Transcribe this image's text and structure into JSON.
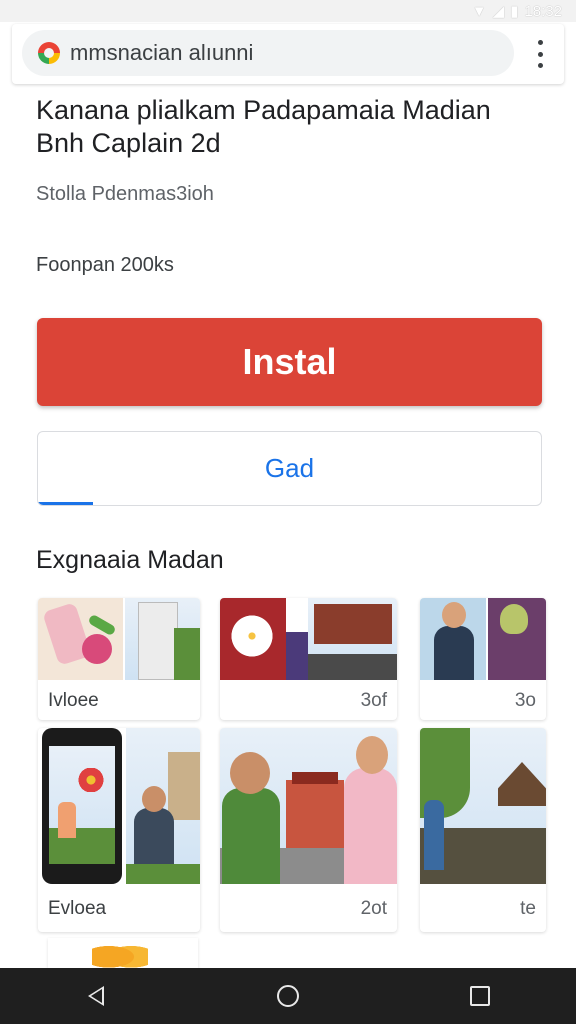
{
  "status_bar": {
    "time": "18:32",
    "icons": [
      "wifi-icon",
      "signal-icon",
      "battery-icon"
    ]
  },
  "browser": {
    "url": "mmsnacian alıunni",
    "menu_icon": "more-vert-icon"
  },
  "app": {
    "title": "Kanana plialkam Padapamaia Madian Bnh Caplain 2d",
    "developer": "Stolla Pdenmas3ioh",
    "downloads": "Foonpan 200ks",
    "install_label": "Instal",
    "secondary_label": "Gad",
    "progress": 0.11
  },
  "section": {
    "heading": "Exgnaaia Madan"
  },
  "cards": [
    {
      "label": "Ivloee",
      "count": ""
    },
    {
      "label": "",
      "count": "3of"
    },
    {
      "label": "",
      "count": "3o"
    },
    {
      "label": "Evloea",
      "count": ""
    },
    {
      "label": "",
      "count": "2ot"
    },
    {
      "label": "",
      "count": "te"
    }
  ],
  "colors": {
    "install": "#db4437",
    "link": "#1a73e8",
    "navbar": "#1f1f1f"
  }
}
